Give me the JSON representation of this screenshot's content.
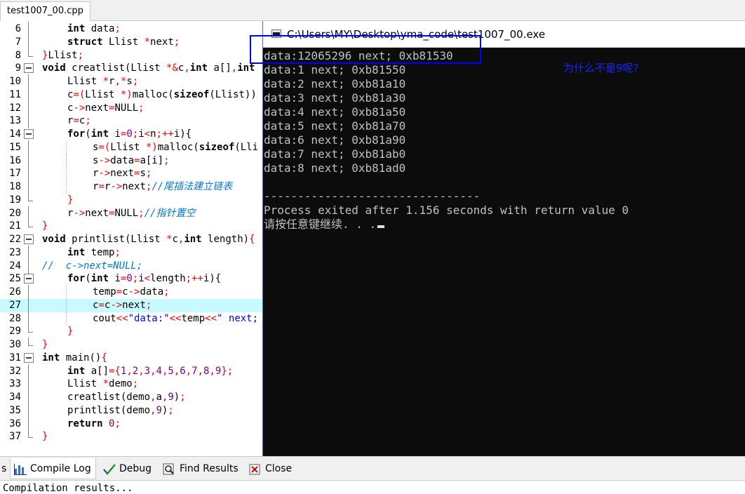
{
  "editor": {
    "file_tab": "test1007_00.cpp",
    "lines": [
      {
        "n": "6",
        "fold": "vline",
        "indent": 1,
        "tokens": [
          [
            "kw",
            "int"
          ],
          [
            "tx",
            " data"
          ],
          [
            "op",
            ";"
          ]
        ]
      },
      {
        "n": "7",
        "fold": "vline",
        "indent": 1,
        "tokens": [
          [
            "kw",
            "struct"
          ],
          [
            "tx",
            " Llist "
          ],
          [
            "op",
            "*"
          ],
          [
            "tx",
            "next"
          ],
          [
            "op",
            ";"
          ]
        ]
      },
      {
        "n": "8",
        "fold": "end",
        "indent": 0,
        "tokens": [
          [
            "op",
            "}"
          ],
          [
            "tx",
            "Llist"
          ],
          [
            "op",
            ";"
          ]
        ]
      },
      {
        "n": "9",
        "fold": "box",
        "indent": 0,
        "tokens": [
          [
            "kw",
            "void"
          ],
          [
            "tx",
            " creatlist(Llist "
          ],
          [
            "op",
            "*&"
          ],
          [
            "tx",
            "c"
          ],
          [
            "op",
            ","
          ],
          [
            "kw",
            "int"
          ],
          [
            "tx",
            " a[]"
          ],
          [
            "op",
            ","
          ],
          [
            "kw",
            "int"
          ]
        ]
      },
      {
        "n": "10",
        "fold": "vline",
        "indent": 1,
        "tokens": [
          [
            "tx",
            "Llist "
          ],
          [
            "op",
            "*"
          ],
          [
            "tx",
            "r"
          ],
          [
            "op",
            ",*"
          ],
          [
            "tx",
            "s"
          ],
          [
            "op",
            ";"
          ]
        ]
      },
      {
        "n": "11",
        "fold": "vline",
        "indent": 1,
        "tokens": [
          [
            "tx",
            "c"
          ],
          [
            "op",
            "=("
          ],
          [
            "tx",
            "Llist "
          ],
          [
            "op",
            "*)"
          ],
          [
            "tx",
            "malloc("
          ],
          [
            "kw",
            "sizeof"
          ],
          [
            "tx",
            "(Llist))"
          ]
        ]
      },
      {
        "n": "12",
        "fold": "vline",
        "indent": 1,
        "tokens": [
          [
            "tx",
            "c"
          ],
          [
            "op",
            "->"
          ],
          [
            "tx",
            "next"
          ],
          [
            "op",
            "="
          ],
          [
            "tx",
            "NULL"
          ],
          [
            "op",
            ";"
          ]
        ]
      },
      {
        "n": "13",
        "fold": "vline",
        "indent": 1,
        "tokens": [
          [
            "tx",
            "r"
          ],
          [
            "op",
            "="
          ],
          [
            "tx",
            "c"
          ],
          [
            "op",
            ";"
          ]
        ]
      },
      {
        "n": "14",
        "fold": "box",
        "indent": 1,
        "tokens": [
          [
            "kw",
            "for"
          ],
          [
            "tx",
            "("
          ],
          [
            "kw",
            "int"
          ],
          [
            "tx",
            " i"
          ],
          [
            "op",
            "="
          ],
          [
            "num",
            "0"
          ],
          [
            "op",
            ";"
          ],
          [
            "tx",
            "i"
          ],
          [
            "op",
            "<"
          ],
          [
            "tx",
            "n"
          ],
          [
            "op",
            ";++"
          ],
          [
            "tx",
            "i){"
          ]
        ]
      },
      {
        "n": "15",
        "fold": "vline",
        "indent": 2,
        "tokens": [
          [
            "tx",
            "s"
          ],
          [
            "op",
            "=("
          ],
          [
            "tx",
            "Llist "
          ],
          [
            "op",
            "*)"
          ],
          [
            "tx",
            "malloc("
          ],
          [
            "kw",
            "sizeof"
          ],
          [
            "tx",
            "(Lli"
          ]
        ]
      },
      {
        "n": "16",
        "fold": "vline",
        "indent": 2,
        "tokens": [
          [
            "tx",
            "s"
          ],
          [
            "op",
            "->"
          ],
          [
            "tx",
            "data"
          ],
          [
            "op",
            "="
          ],
          [
            "tx",
            "a[i]"
          ],
          [
            "op",
            ";"
          ]
        ]
      },
      {
        "n": "17",
        "fold": "vline",
        "indent": 2,
        "tokens": [
          [
            "tx",
            "r"
          ],
          [
            "op",
            "->"
          ],
          [
            "tx",
            "next"
          ],
          [
            "op",
            "="
          ],
          [
            "tx",
            "s"
          ],
          [
            "op",
            ";"
          ]
        ]
      },
      {
        "n": "18",
        "fold": "vline",
        "indent": 2,
        "tokens": [
          [
            "tx",
            "r"
          ],
          [
            "op",
            "="
          ],
          [
            "tx",
            "r"
          ],
          [
            "op",
            "->"
          ],
          [
            "tx",
            "next"
          ],
          [
            "op",
            ";"
          ],
          [
            "cm",
            "//尾插法建立链表"
          ]
        ]
      },
      {
        "n": "19",
        "fold": "end",
        "indent": 1,
        "tokens": [
          [
            "op",
            "}"
          ]
        ]
      },
      {
        "n": "20",
        "fold": "vline",
        "indent": 1,
        "tokens": [
          [
            "tx",
            "r"
          ],
          [
            "op",
            "->"
          ],
          [
            "tx",
            "next"
          ],
          [
            "op",
            "="
          ],
          [
            "tx",
            "NULL"
          ],
          [
            "op",
            ";"
          ],
          [
            "cm",
            "//指针置空"
          ]
        ]
      },
      {
        "n": "21",
        "fold": "end",
        "indent": 0,
        "tokens": [
          [
            "op",
            "}"
          ]
        ]
      },
      {
        "n": "22",
        "fold": "box",
        "indent": 0,
        "tokens": [
          [
            "kw",
            "void"
          ],
          [
            "tx",
            " printlist(Llist "
          ],
          [
            "op",
            "*"
          ],
          [
            "tx",
            "c"
          ],
          [
            "op",
            ","
          ],
          [
            "kw",
            "int"
          ],
          [
            "tx",
            " length)"
          ],
          [
            "op",
            "{"
          ]
        ]
      },
      {
        "n": "23",
        "fold": "vline",
        "indent": 1,
        "tokens": [
          [
            "kw",
            "int"
          ],
          [
            "tx",
            " temp"
          ],
          [
            "op",
            ";"
          ]
        ]
      },
      {
        "n": "24",
        "fold": "vline",
        "indent": 0,
        "tokens": [
          [
            "cm",
            "//  c->next=NULL;"
          ]
        ]
      },
      {
        "n": "25",
        "fold": "box",
        "indent": 1,
        "tokens": [
          [
            "kw",
            "for"
          ],
          [
            "tx",
            "("
          ],
          [
            "kw",
            "int"
          ],
          [
            "tx",
            " i"
          ],
          [
            "op",
            "="
          ],
          [
            "num",
            "0"
          ],
          [
            "op",
            ";"
          ],
          [
            "tx",
            "i"
          ],
          [
            "op",
            "<"
          ],
          [
            "tx",
            "length"
          ],
          [
            "op",
            ";++"
          ],
          [
            "tx",
            "i){"
          ]
        ]
      },
      {
        "n": "26",
        "fold": "vline",
        "indent": 2,
        "tokens": [
          [
            "tx",
            "temp"
          ],
          [
            "op",
            "="
          ],
          [
            "tx",
            "c"
          ],
          [
            "op",
            "->"
          ],
          [
            "tx",
            "data"
          ],
          [
            "op",
            ";"
          ]
        ]
      },
      {
        "n": "27",
        "fold": "vline",
        "indent": 2,
        "highlight": true,
        "tokens": [
          [
            "tx",
            "c"
          ],
          [
            "op",
            "="
          ],
          [
            "tx",
            "c"
          ],
          [
            "op",
            "->"
          ],
          [
            "tx",
            "next"
          ],
          [
            "op",
            ";"
          ]
        ]
      },
      {
        "n": "28",
        "fold": "vline",
        "indent": 2,
        "tokens": [
          [
            "tx",
            "cout"
          ],
          [
            "op",
            "<<"
          ],
          [
            "str",
            "\"data:\""
          ],
          [
            "op",
            "<<"
          ],
          [
            "tx",
            "temp"
          ],
          [
            "op",
            "<<"
          ],
          [
            "str",
            "\" next;"
          ]
        ]
      },
      {
        "n": "29",
        "fold": "end",
        "indent": 1,
        "tokens": [
          [
            "op",
            "}"
          ]
        ]
      },
      {
        "n": "30",
        "fold": "end",
        "indent": 0,
        "tokens": [
          [
            "op",
            "}"
          ]
        ]
      },
      {
        "n": "31",
        "fold": "box",
        "indent": 0,
        "tokens": [
          [
            "kw",
            "int"
          ],
          [
            "tx",
            " main()"
          ],
          [
            "op",
            "{"
          ]
        ]
      },
      {
        "n": "32",
        "fold": "vline",
        "indent": 1,
        "tokens": [
          [
            "kw",
            "int"
          ],
          [
            "tx",
            " a[]"
          ],
          [
            "op",
            "={"
          ],
          [
            "num",
            "1"
          ],
          [
            "op",
            ","
          ],
          [
            "num",
            "2"
          ],
          [
            "op",
            ","
          ],
          [
            "num",
            "3"
          ],
          [
            "op",
            ","
          ],
          [
            "num",
            "4"
          ],
          [
            "op",
            ","
          ],
          [
            "num",
            "5"
          ],
          [
            "op",
            ","
          ],
          [
            "num",
            "6"
          ],
          [
            "op",
            ","
          ],
          [
            "num",
            "7"
          ],
          [
            "op",
            ","
          ],
          [
            "num",
            "8"
          ],
          [
            "op",
            ","
          ],
          [
            "num",
            "9"
          ],
          [
            "op",
            "};"
          ]
        ]
      },
      {
        "n": "33",
        "fold": "vline",
        "indent": 1,
        "tokens": [
          [
            "tx",
            "Llist "
          ],
          [
            "op",
            "*"
          ],
          [
            "tx",
            "demo"
          ],
          [
            "op",
            ";"
          ]
        ]
      },
      {
        "n": "34",
        "fold": "vline",
        "indent": 1,
        "tokens": [
          [
            "tx",
            "creatlist(demo"
          ],
          [
            "op",
            ","
          ],
          [
            "tx",
            "a"
          ],
          [
            "op",
            ","
          ],
          [
            "num",
            "9"
          ],
          [
            "tx",
            ")"
          ],
          [
            "op",
            ";"
          ]
        ]
      },
      {
        "n": "35",
        "fold": "vline",
        "indent": 1,
        "tokens": [
          [
            "tx",
            "printlist(demo"
          ],
          [
            "op",
            ","
          ],
          [
            "num",
            "9"
          ],
          [
            "tx",
            ")"
          ],
          [
            "op",
            ";"
          ]
        ]
      },
      {
        "n": "36",
        "fold": "vline",
        "indent": 1,
        "tokens": [
          [
            "kw",
            "return"
          ],
          [
            "tx",
            " "
          ],
          [
            "num",
            "0"
          ],
          [
            "op",
            ";"
          ]
        ]
      },
      {
        "n": "37",
        "fold": "end",
        "indent": 0,
        "tokens": [
          [
            "op",
            "}"
          ]
        ]
      }
    ]
  },
  "console": {
    "title": "C:\\Users\\MY\\Desktop\\yma_code\\test1007_00.exe",
    "lines": [
      "data:12065296 next; 0xb81530",
      "data:1 next; 0xb81550",
      "data:2 next; 0xb81a10",
      "data:3 next; 0xb81a30",
      "data:4 next; 0xb81a50",
      "data:5 next; 0xb81a70",
      "data:6 next; 0xb81a90",
      "data:7 next; 0xb81ab0",
      "data:8 next; 0xb81ad0",
      "",
      "--------------------------------",
      "Process exited after 1.156 seconds with return value 0",
      "请按任意键继续. . ."
    ]
  },
  "annotation": {
    "note": "为什么不是9呢?",
    "box_color": "#0000ff",
    "note_color": "#1428ff"
  },
  "bottom_panel": {
    "tabs": [
      {
        "id": "partial",
        "label": "s",
        "icon": ""
      },
      {
        "id": "compile-log",
        "label": "Compile Log",
        "icon": "bar-chart-icon",
        "active": true
      },
      {
        "id": "debug",
        "label": "Debug",
        "icon": "check-icon"
      },
      {
        "id": "find-results",
        "label": "Find Results",
        "icon": "find-icon"
      },
      {
        "id": "close",
        "label": "Close",
        "icon": "close-icon"
      }
    ],
    "compilation_text": "Compilation results..."
  },
  "colors": {
    "console_bg": "#0c0c0c",
    "console_fg": "#c0c0c0",
    "highlight_line": "#c7fbff",
    "operator": "#ff0000",
    "number": "#800080",
    "string": "#0000ff",
    "comment": "#0078d7"
  }
}
